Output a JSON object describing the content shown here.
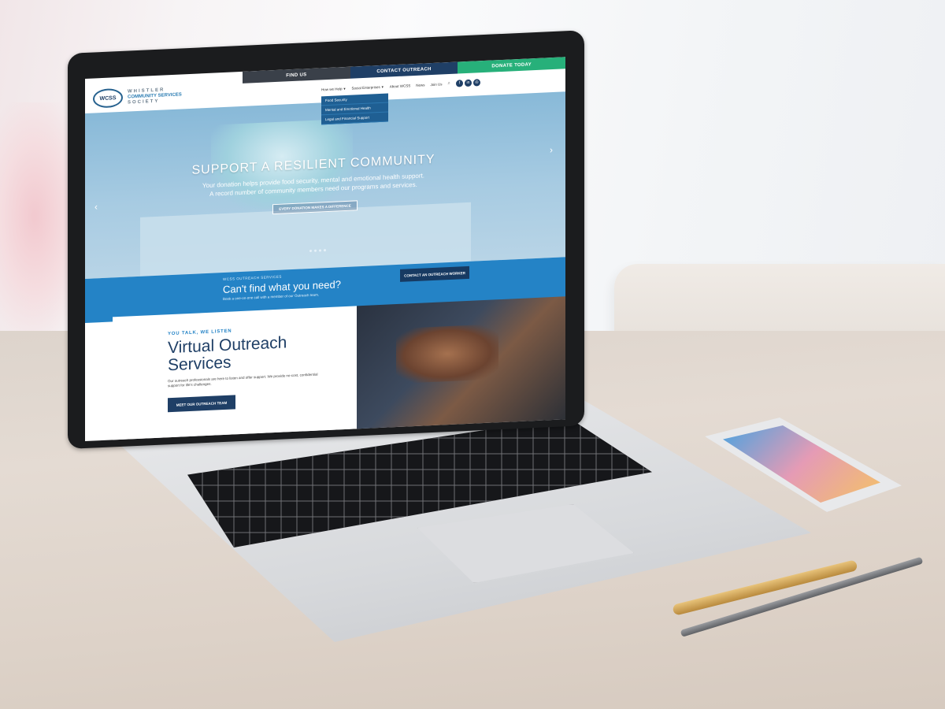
{
  "site": {
    "topbar": {
      "find_us": "FIND US",
      "contact_outreach": "CONTACT OUTREACH",
      "donate_today": "DONATE TODAY"
    },
    "logo": {
      "badge": "WCSS",
      "line1": "WHISTLER",
      "line2": "COMMUNITY SERVICES",
      "line3": "SOCIETY"
    },
    "nav": {
      "items": [
        "How we Help",
        "Social Enterprises",
        "About WCSS",
        "News",
        "Join Us"
      ],
      "social_icons": [
        "facebook-icon",
        "linkedin-icon",
        "instagram-icon"
      ]
    },
    "dropdown": {
      "items": [
        "Food Security",
        "Mental and Emotional Health",
        "Legal and Financial Support"
      ]
    },
    "hero": {
      "title": "SUPPORT A RESILIENT COMMUNITY",
      "subtitle_line1": "Your donation helps provide food security, mental and emotional health support.",
      "subtitle_line2": "A record number of community members need our programs and services.",
      "cta": "EVERY DONATION MAKES A DIFFERENCE"
    },
    "outreach": {
      "label": "WCSS OUTREACH SERVICES",
      "title": "Can't find what you need?",
      "subtitle": "Book a one-on-one call with a member of our Outreach team.",
      "button": "CONTACT AN OUTREACH WORKER"
    },
    "virtual": {
      "label": "YOU TALK, WE LISTEN",
      "title": "Virtual Outreach Services",
      "description": "Our outreach professionals are here to listen and offer support. We provide no-cost, confidential support for life's challenges.",
      "button": "MEET OUR OUTREACH TEAM"
    }
  },
  "colors": {
    "navy": "#1f3f66",
    "blue": "#2483c6",
    "green": "#27b07a",
    "dark_gray": "#3a4049"
  }
}
